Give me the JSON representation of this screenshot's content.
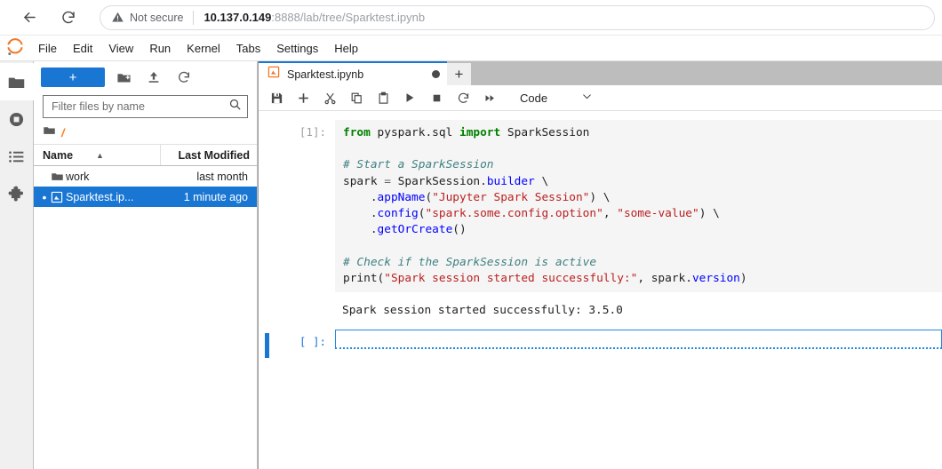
{
  "browser": {
    "back_icon": "arrow-left-icon",
    "reload_icon": "reload-icon",
    "security_icon": "warning-triangle-icon",
    "security_label": "Not secure",
    "url_host": "10.137.0.149",
    "url_path": ":8888/lab/tree/Sparktest.ipynb"
  },
  "menubar": {
    "logo": "jupyter-logo",
    "items": [
      {
        "label": "File"
      },
      {
        "label": "Edit"
      },
      {
        "label": "View"
      },
      {
        "label": "Run"
      },
      {
        "label": "Kernel"
      },
      {
        "label": "Tabs"
      },
      {
        "label": "Settings"
      },
      {
        "label": "Help"
      }
    ]
  },
  "activity_bar": {
    "items": [
      {
        "name": "file-browser",
        "icon": "folder-icon",
        "active": true
      },
      {
        "name": "running-kernels",
        "icon": "running-terminals-icon",
        "active": false
      },
      {
        "name": "command-palette",
        "icon": "list-icon",
        "active": false
      },
      {
        "name": "extension-manager",
        "icon": "puzzle-piece-icon",
        "active": false
      }
    ]
  },
  "filebrowser": {
    "new_launcher_label": "+",
    "new_folder_icon": "new-folder-icon",
    "upload_icon": "upload-icon",
    "refresh_icon": "refresh-icon",
    "filter_placeholder": "Filter files by name",
    "filter_value": "",
    "search_icon": "search-icon",
    "breadcrumb_root": "/",
    "breadcrumb_icon": "folder-icon",
    "columns": {
      "name": "Name",
      "last_modified": "Last Modified"
    },
    "sort_caret": "▲",
    "rows": [
      {
        "name": "work",
        "modified": "last month",
        "icon": "folder-icon",
        "selected": false,
        "running": false
      },
      {
        "name": "Sparktest.ip...",
        "modified": "1 minute ago",
        "icon": "notebook-icon",
        "selected": true,
        "running": true
      }
    ]
  },
  "notebook": {
    "tab": {
      "icon": "notebook-icon",
      "label": "Sparktest.ipynb",
      "dirty": true
    },
    "add_tab_label": "+",
    "toolbar": {
      "buttons": [
        {
          "name": "save-button",
          "icon": "save-icon"
        },
        {
          "name": "insert-cell-button",
          "icon": "plus-icon"
        },
        {
          "name": "cut-cell-button",
          "icon": "scissors-icon"
        },
        {
          "name": "copy-cell-button",
          "icon": "copy-icon"
        },
        {
          "name": "paste-cell-button",
          "icon": "clipboard-icon"
        },
        {
          "name": "run-cell-button",
          "icon": "play-icon"
        },
        {
          "name": "interrupt-kernel-button",
          "icon": "stop-square-icon"
        },
        {
          "name": "restart-kernel-button",
          "icon": "restart-circle-icon"
        },
        {
          "name": "restart-run-all-button",
          "icon": "fast-forward-icon"
        }
      ],
      "cell_type_value": "Code",
      "cell_type_caret": "chevron-down-icon"
    },
    "cells": [
      {
        "prompt": "[1]:",
        "executed": true,
        "active": false,
        "source_lines": [
          [
            {
              "t": "from ",
              "c": "tok-kw"
            },
            {
              "t": "pyspark.sql ",
              "c": "tok-name"
            },
            {
              "t": "import ",
              "c": "tok-kw"
            },
            {
              "t": "SparkSession",
              "c": "tok-name"
            }
          ],
          [],
          [
            {
              "t": "# Start a SparkSession",
              "c": "tok-com"
            }
          ],
          [
            {
              "t": "spark ",
              "c": "tok-name"
            },
            {
              "t": "= ",
              "c": "tok-op"
            },
            {
              "t": "SparkSession.",
              "c": "tok-name"
            },
            {
              "t": "builder",
              "c": "tok-attr"
            },
            {
              "t": " \\",
              "c": "tok-name"
            }
          ],
          [
            {
              "t": "    .",
              "c": "tok-name"
            },
            {
              "t": "appName",
              "c": "tok-attr"
            },
            {
              "t": "(",
              "c": "tok-name"
            },
            {
              "t": "\"Jupyter Spark Session\"",
              "c": "tok-str"
            },
            {
              "t": ") \\",
              "c": "tok-name"
            }
          ],
          [
            {
              "t": "    .",
              "c": "tok-name"
            },
            {
              "t": "config",
              "c": "tok-attr"
            },
            {
              "t": "(",
              "c": "tok-name"
            },
            {
              "t": "\"spark.some.config.option\"",
              "c": "tok-str"
            },
            {
              "t": ", ",
              "c": "tok-name"
            },
            {
              "t": "\"some-value\"",
              "c": "tok-str"
            },
            {
              "t": ") \\",
              "c": "tok-name"
            }
          ],
          [
            {
              "t": "    .",
              "c": "tok-name"
            },
            {
              "t": "getOrCreate",
              "c": "tok-attr"
            },
            {
              "t": "()",
              "c": "tok-name"
            }
          ],
          [],
          [
            {
              "t": "# Check if the SparkSession is active",
              "c": "tok-com"
            }
          ],
          [
            {
              "t": "print",
              "c": "tok-name"
            },
            {
              "t": "(",
              "c": "tok-name"
            },
            {
              "t": "\"Spark session started successfully:\"",
              "c": "tok-str"
            },
            {
              "t": ", spark.",
              "c": "tok-name"
            },
            {
              "t": "version",
              "c": "tok-attr"
            },
            {
              "t": ")",
              "c": "tok-name"
            }
          ]
        ],
        "output_text": "Spark session started successfully: 3.5.0"
      },
      {
        "prompt": "[ ]:",
        "executed": false,
        "active": true,
        "source_lines": [],
        "output_text": ""
      }
    ]
  },
  "colors": {
    "accent_blue": "#1976d2",
    "cell_border_blue": "#2089e0",
    "tabbar_gray": "#bdbdbd",
    "code_bg": "#f5f5f5",
    "jupyter_orange": "#f37726",
    "string_red": "#ba2121",
    "keyword_green": "#008000",
    "comment_teal": "#408080",
    "attr_blue": "#0000ff"
  }
}
